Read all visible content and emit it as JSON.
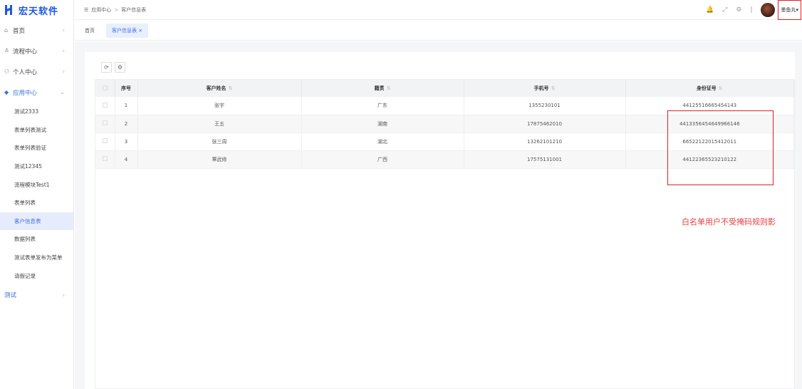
{
  "app": {
    "name": "宏天软件",
    "brand_color": "#1f56e0"
  },
  "sidebar": {
    "items": [
      {
        "label": "首页",
        "icon": "home-icon"
      },
      {
        "label": "流程中心",
        "icon": "flow-icon"
      },
      {
        "label": "个人中心",
        "icon": "user-icon"
      },
      {
        "label": "应用中心",
        "icon": "app-icon"
      }
    ],
    "sub_items": [
      "测试2333",
      "表单列表测试",
      "表单列表验证",
      "测试12345",
      "流程模块Test1",
      "表单列表",
      "客户信息表",
      "数据列表",
      "测试表单发布为菜单",
      "请假记录"
    ],
    "active_sub": "客户信息表",
    "last_item": "测试"
  },
  "header": {
    "breadcrumb": [
      "应用中心",
      "客户信息表"
    ],
    "username": "墨鱼丸"
  },
  "tabs": [
    {
      "label": "首页"
    },
    {
      "label": "客户信息表 ×"
    }
  ],
  "table": {
    "columns": [
      "序号",
      "客户姓名",
      "籍贯",
      "手机号",
      "身份证号"
    ],
    "rows": [
      [
        "1",
        "张宇",
        "广东",
        "1355230101",
        "441255166654541​43"
      ],
      [
        "2",
        "王五",
        "湖南",
        "17875462010",
        "441335645464996​6146"
      ],
      [
        "3",
        "张三周",
        "湖北",
        "13262101210",
        "665221220154120​11"
      ],
      [
        "4",
        "覃武修",
        "广西",
        "17575131001",
        "441223655232101​22"
      ]
    ]
  },
  "note": "白名单用户不受掩码规则影"
}
